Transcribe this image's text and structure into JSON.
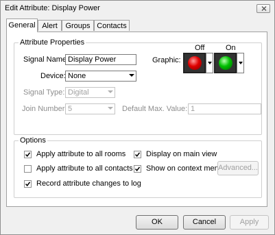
{
  "window": {
    "title": "Edit Attribute: Display Power"
  },
  "tabs": [
    {
      "label": "General",
      "active": true
    },
    {
      "label": "Alert",
      "active": false
    },
    {
      "label": "Groups",
      "active": false
    },
    {
      "label": "Contacts",
      "active": false
    }
  ],
  "attribute_properties": {
    "group_label": "Attribute Properties",
    "signal_name": {
      "label": "Signal Name:",
      "value": "Display Power"
    },
    "device": {
      "label": "Device:",
      "value": "None"
    },
    "signal_type": {
      "label": "Signal Type:",
      "value": "Digital"
    },
    "join_number": {
      "label": "Join Number:",
      "value": "5"
    },
    "default_max_value": {
      "label": "Default Max. Value:",
      "value": "1"
    },
    "graphic": {
      "label": "Graphic:",
      "off_label": "Off",
      "on_label": "On",
      "off_icon": "red-ball-icon",
      "on_icon": "green-ball-icon",
      "off_color": "#e00000",
      "on_color": "#00c000"
    }
  },
  "options": {
    "group_label": "Options",
    "apply_all_rooms": {
      "label": "Apply attribute to all rooms",
      "checked": true
    },
    "apply_all_contacts": {
      "label": "Apply attribute to all contacts",
      "checked": false
    },
    "record_changes": {
      "label": "Record attribute changes to log",
      "checked": true
    },
    "display_main_view": {
      "label": "Display on main view",
      "checked": true
    },
    "show_context_menu": {
      "label": "Show on context menu",
      "checked": true
    },
    "advanced_label": "Advanced..."
  },
  "footer": {
    "ok_label": "OK",
    "cancel_label": "Cancel",
    "apply_label": "Apply"
  },
  "colors": {
    "window_bg": "#f0f0f0",
    "panel_bg": "#ffffff",
    "disabled_text": "#8d8d8d"
  }
}
